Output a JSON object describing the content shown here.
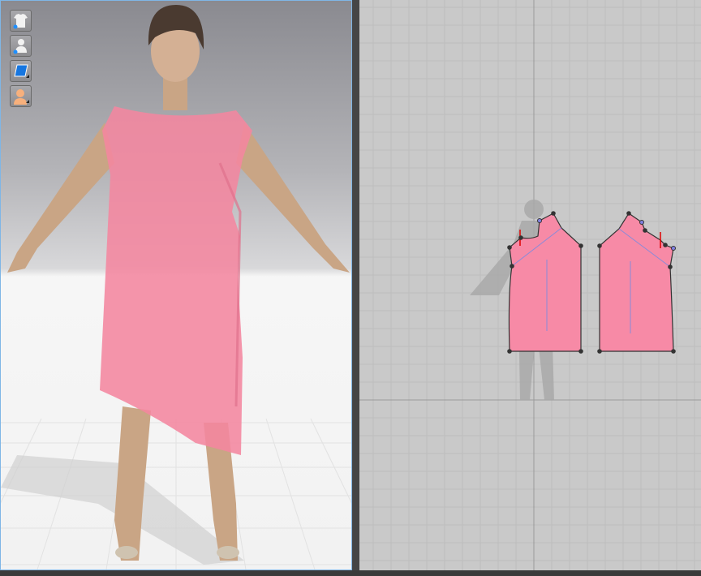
{
  "window": {
    "panels": [
      "3d-garment-view",
      "2d-pattern-view"
    ]
  },
  "toolbar_3d": {
    "buttons": [
      {
        "icon": "garment-shirt-icon",
        "has_indicator": true
      },
      {
        "icon": "avatar-silhouette-icon",
        "has_indicator": true
      },
      {
        "icon": "texture-plane-icon",
        "has_submenu": true
      },
      {
        "icon": "avatar-skin-icon",
        "has_submenu": true
      }
    ]
  },
  "colors": {
    "fabric": "#f4869f",
    "view3d_border": "#7fb6e6",
    "pattern_fill": "#f78aa6",
    "pattern_baseline": "#8a8ad8",
    "notch": "#e00000",
    "grid_bg": "#c9c9c9"
  },
  "pattern_pieces": [
    {
      "name": "front-bodice",
      "notches": 1
    },
    {
      "name": "back-bodice",
      "notches": 1
    }
  ]
}
